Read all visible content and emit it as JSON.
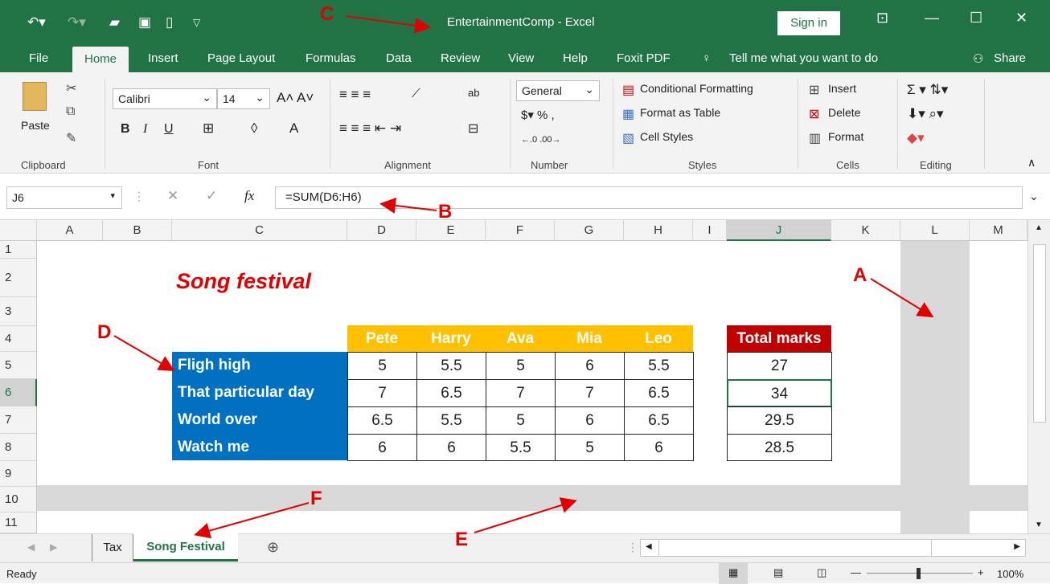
{
  "titlebar": {
    "title": "EntertainmentComp  -  Excel",
    "sign_in": "Sign in"
  },
  "tabs": [
    "File",
    "Home",
    "Insert",
    "Page Layout",
    "Formulas",
    "Data",
    "Review",
    "View",
    "Help",
    "Foxit PDF"
  ],
  "tell_me": "Tell me what you want to do",
  "share": "Share",
  "ribbon": {
    "paste": "Paste",
    "font_name": "Calibri",
    "font_size": "14",
    "number_format": "General",
    "conditional_formatting": "Conditional Formatting",
    "format_as_table": "Format as Table",
    "cell_styles": "Cell Styles",
    "insert": "Insert",
    "delete": "Delete",
    "format": "Format",
    "groups": [
      "Clipboard",
      "Font",
      "Alignment",
      "Number",
      "Styles",
      "Cells",
      "Editing"
    ]
  },
  "formula_bar": {
    "name_box": "J6",
    "fx": "fx",
    "formula": "=SUM(D6:H6)"
  },
  "columns": [
    "A",
    "B",
    "C",
    "D",
    "E",
    "F",
    "G",
    "H",
    "I",
    "J",
    "K",
    "L",
    "M"
  ],
  "rows": [
    "1",
    "2",
    "3",
    "4",
    "5",
    "6",
    "7",
    "8",
    "9",
    "10",
    "11"
  ],
  "sheet": {
    "title": "Song festival",
    "headers": [
      "Pete",
      "Harry",
      "Ava",
      "Mia",
      "Leo"
    ],
    "total_header": "Total marks",
    "songs": [
      "Fligh high",
      "That particular day",
      "World over",
      "Watch me"
    ],
    "scores": [
      [
        "5",
        "5.5",
        "5",
        "6",
        "5.5"
      ],
      [
        "7",
        "6.5",
        "7",
        "7",
        "6.5"
      ],
      [
        "6.5",
        "5.5",
        "5",
        "6",
        "6.5"
      ],
      [
        "6",
        "6",
        "5.5",
        "5",
        "6"
      ]
    ],
    "totals": [
      "27",
      "34",
      "29.5",
      "28.5"
    ]
  },
  "annotations": [
    "A",
    "B",
    "C",
    "D",
    "E",
    "F"
  ],
  "sheet_tabs": [
    "Tax",
    "Song Festival"
  ],
  "status": {
    "ready": "Ready",
    "zoom": "100%"
  }
}
